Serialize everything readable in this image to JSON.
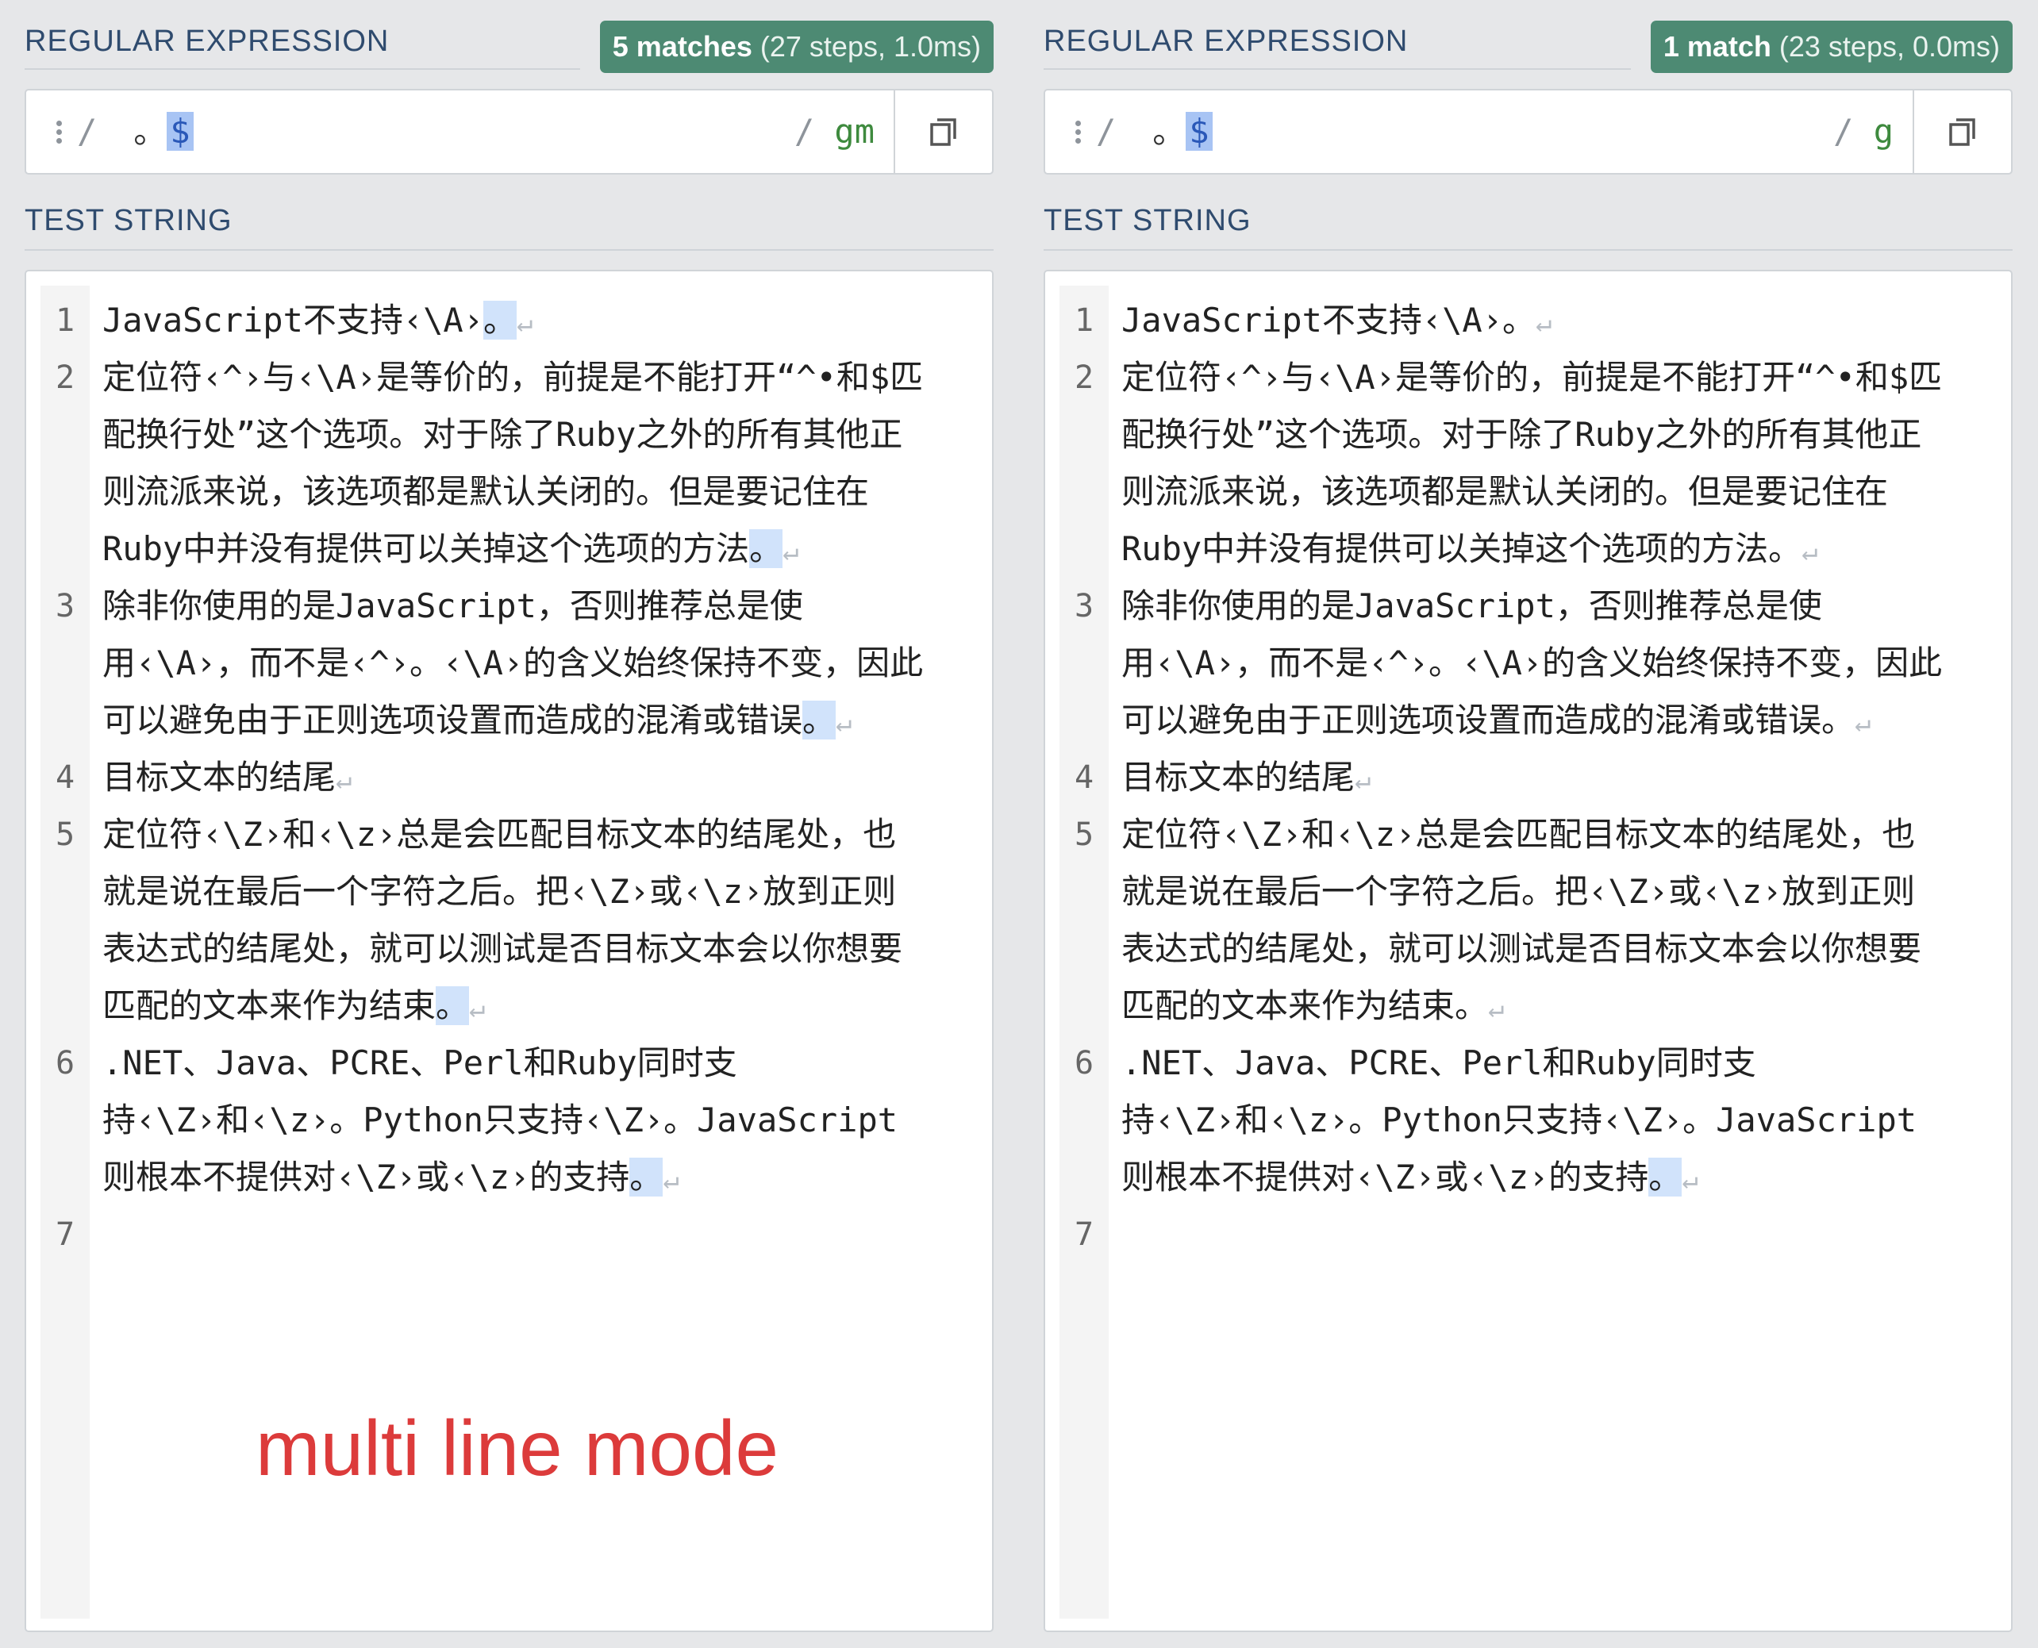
{
  "panels": [
    {
      "regex_label": "REGULAR EXPRESSION",
      "badge_strong": "5 matches",
      "badge_rest": " (27 steps, 1.0ms)",
      "delimiter": "/",
      "pattern_prefix": " 。",
      "pattern_anchor": "$",
      "flags": "gm",
      "test_label": "TEST STRING",
      "lines": [
        {
          "num": "1",
          "segs": [
            {
              "pre": "JavaScript不支持‹\\A›",
              "mark": "。"
            }
          ]
        },
        {
          "num": "2",
          "segs": [
            {
              "pre": "定位符‹^›与‹\\A›是等价的，前提是不能打开“^•和$匹"
            },
            {
              "pre": "配换行处”这个选项。对于除了Ruby之外的所有其他正"
            },
            {
              "pre": "则流派来说，该选项都是默认关闭的。但是要记住在"
            },
            {
              "pre": "Ruby中并没有提供可以关掉这个选项的方法",
              "mark": "。"
            }
          ]
        },
        {
          "num": "3",
          "segs": [
            {
              "pre": "除非你使用的是JavaScript，否则推荐总是使"
            },
            {
              "pre": "用‹\\A›，而不是‹^›。‹\\A›的含义始终保持不变，因此"
            },
            {
              "pre": "可以避免由于正则选项设置而造成的混淆或错误",
              "mark": "。"
            }
          ]
        },
        {
          "num": "4",
          "segs": [
            {
              "pre": "目标文本的结尾",
              "nl": true
            }
          ]
        },
        {
          "num": "5",
          "segs": [
            {
              "pre": "定位符‹\\Z›和‹\\z›总是会匹配目标文本的结尾处，也"
            },
            {
              "pre": "就是说在最后一个字符之后。把‹\\Z›或‹\\z›放到正则"
            },
            {
              "pre": "表达式的结尾处，就可以测试是否目标文本会以你想要"
            },
            {
              "pre": "匹配的文本来作为结束",
              "mark": "。"
            }
          ]
        },
        {
          "num": "6",
          "segs": [
            {
              "pre": ".NET、Java、PCRE、Perl和Ruby同时支"
            },
            {
              "pre": "持‹\\Z›和‹\\z›。Python只支持‹\\Z›。JavaScript"
            },
            {
              "pre": "则根本不提供对‹\\Z›或‹\\z›的支持",
              "mark": "。"
            }
          ]
        },
        {
          "num": "7",
          "segs": [
            {
              "pre": ""
            }
          ]
        }
      ],
      "annotation": "multi line mode"
    },
    {
      "regex_label": "REGULAR EXPRESSION",
      "badge_strong": "1 match",
      "badge_rest": " (23 steps, 0.0ms)",
      "delimiter": "/",
      "pattern_prefix": " 。",
      "pattern_anchor": "$",
      "flags": "g",
      "test_label": "TEST STRING",
      "lines": [
        {
          "num": "1",
          "segs": [
            {
              "pre": "JavaScript不支持‹\\A›。",
              "nl": true
            }
          ]
        },
        {
          "num": "2",
          "segs": [
            {
              "pre": "定位符‹^›与‹\\A›是等价的，前提是不能打开“^•和$匹"
            },
            {
              "pre": "配换行处”这个选项。对于除了Ruby之外的所有其他正"
            },
            {
              "pre": "则流派来说，该选项都是默认关闭的。但是要记住在"
            },
            {
              "pre": "Ruby中并没有提供可以关掉这个选项的方法。",
              "nl": true
            }
          ]
        },
        {
          "num": "3",
          "segs": [
            {
              "pre": "除非你使用的是JavaScript，否则推荐总是使"
            },
            {
              "pre": "用‹\\A›，而不是‹^›。‹\\A›的含义始终保持不变，因此"
            },
            {
              "pre": "可以避免由于正则选项设置而造成的混淆或错误。",
              "nl": true
            }
          ]
        },
        {
          "num": "4",
          "segs": [
            {
              "pre": "目标文本的结尾",
              "nl": true
            }
          ]
        },
        {
          "num": "5",
          "segs": [
            {
              "pre": "定位符‹\\Z›和‹\\z›总是会匹配目标文本的结尾处，也"
            },
            {
              "pre": "就是说在最后一个字符之后。把‹\\Z›或‹\\z›放到正则"
            },
            {
              "pre": "表达式的结尾处，就可以测试是否目标文本会以你想要"
            },
            {
              "pre": "匹配的文本来作为结束。",
              "nl": true
            }
          ]
        },
        {
          "num": "6",
          "segs": [
            {
              "pre": ".NET、Java、PCRE、Perl和Ruby同时支"
            },
            {
              "pre": "持‹\\Z›和‹\\z›。Python只支持‹\\Z›。JavaScript"
            },
            {
              "pre": "则根本不提供对‹\\Z›或‹\\z›的支持",
              "mark": "。"
            }
          ]
        },
        {
          "num": "7",
          "segs": [
            {
              "pre": ""
            }
          ]
        }
      ],
      "annotation": ""
    }
  ],
  "icons": {
    "copy": "copy-icon",
    "drag": "drag-handle-icon",
    "newline": "newline-symbol-icon"
  },
  "colors": {
    "badge_bg": "#4d8a73",
    "match_highlight": "#d1e3fb",
    "anchor_highlight": "#a8c4f4",
    "annotation": "#dc3b3b",
    "heading": "#2f4b6e"
  }
}
